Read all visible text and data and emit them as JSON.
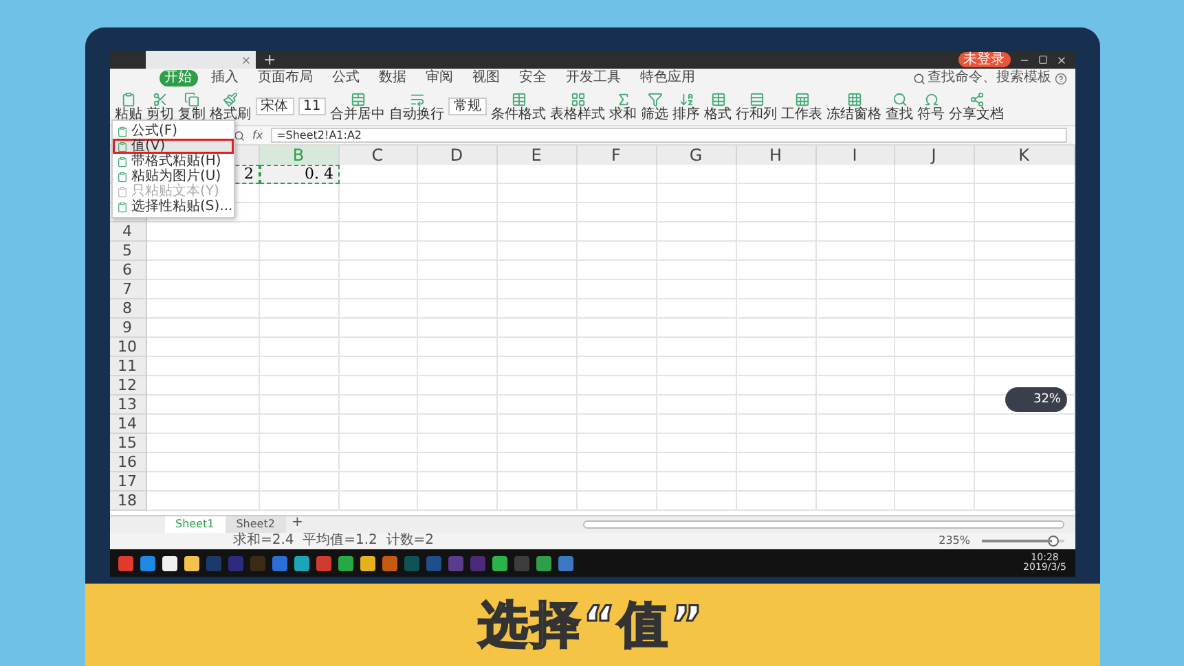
{
  "window": {
    "login_badge": "未登录",
    "new_tab": "+",
    "search_placeholder": "查找命令、搜索模板"
  },
  "menu_tabs": [
    {
      "label": "开始",
      "selected": true
    },
    {
      "label": "插入",
      "selected": false
    },
    {
      "label": "页面布局",
      "selected": false
    },
    {
      "label": "公式",
      "selected": false
    },
    {
      "label": "数据",
      "selected": false
    },
    {
      "label": "审阅",
      "selected": false
    },
    {
      "label": "视图",
      "selected": false
    },
    {
      "label": "安全",
      "selected": false
    },
    {
      "label": "开发工具",
      "selected": false
    },
    {
      "label": "特色应用",
      "selected": false
    }
  ],
  "ribbon": {
    "font_name": "宋体",
    "font_size": "11",
    "number_format": "常规",
    "buttons": [
      "粘贴",
      "剪切",
      "复制",
      "格式刷",
      "合并居中",
      "自动换行",
      "条件格式",
      "表格样式",
      "求和",
      "筛选",
      "排序",
      "格式",
      "行和列",
      "工作表",
      "冻结窗格",
      "查找",
      "符号",
      "分享文档"
    ]
  },
  "paste_menu": [
    {
      "label": "公式(F)",
      "selected": false,
      "disabled": false
    },
    {
      "label": "值(V)",
      "selected": true,
      "disabled": false
    },
    {
      "label": "带格式粘贴(H)",
      "selected": false,
      "disabled": false
    },
    {
      "label": "粘贴为图片(U)",
      "selected": false,
      "disabled": false
    },
    {
      "label": "只粘贴文本(Y)",
      "selected": false,
      "disabled": true
    },
    {
      "label": "选择性粘贴(S)...",
      "selected": false,
      "disabled": false
    }
  ],
  "formula_bar": {
    "fx": "fx",
    "formula": "=Sheet2!A1:A2"
  },
  "columns": [
    {
      "selected": false
    },
    {
      "label": "B",
      "selected": true
    },
    {
      "label": "C",
      "selected": false
    },
    {
      "label": "D",
      "selected": false
    },
    {
      "label": "E",
      "selected": false
    },
    {
      "label": "F",
      "selected": false
    },
    {
      "label": "G",
      "selected": false
    },
    {
      "label": "H",
      "selected": false
    },
    {
      "label": "I",
      "selected": false
    },
    {
      "label": "J",
      "selected": false
    },
    {
      "label": "K",
      "selected": false
    }
  ],
  "rows": [
    {
      "cells": [
        {
          "text": "2",
          "copied": true
        },
        {
          "text": "0. 4",
          "copied": true
        }
      ]
    },
    {
      "cells": []
    },
    {
      "cells": []
    },
    {
      "label": "4",
      "cells": []
    },
    {
      "label": "5",
      "cells": []
    },
    {
      "label": "6",
      "cells": []
    },
    {
      "label": "7",
      "cells": []
    },
    {
      "label": "8",
      "cells": []
    },
    {
      "label": "9",
      "cells": []
    },
    {
      "label": "10",
      "cells": []
    },
    {
      "label": "11",
      "cells": []
    },
    {
      "label": "12",
      "cells": []
    },
    {
      "label": "13",
      "cells": []
    },
    {
      "label": "14",
      "cells": []
    },
    {
      "label": "15",
      "cells": []
    },
    {
      "label": "16",
      "cells": []
    },
    {
      "label": "17",
      "cells": []
    },
    {
      "label": "18",
      "cells": []
    }
  ],
  "sheets": [
    {
      "label": "Sheet1",
      "selected": true
    },
    {
      "label": "Sheet2",
      "selected": false
    }
  ],
  "add_sheet": "+",
  "status": {
    "summary": "求和=2.4  平均值=1.2  计数=2",
    "zoom": "235%",
    "zoom_slider": {
      "level": 0.85
    }
  },
  "net_widget": {
    "percent": "32%"
  },
  "taskbar": {
    "time": "10:28",
    "date": "2019/3/5"
  },
  "caption": "选择“值”"
}
